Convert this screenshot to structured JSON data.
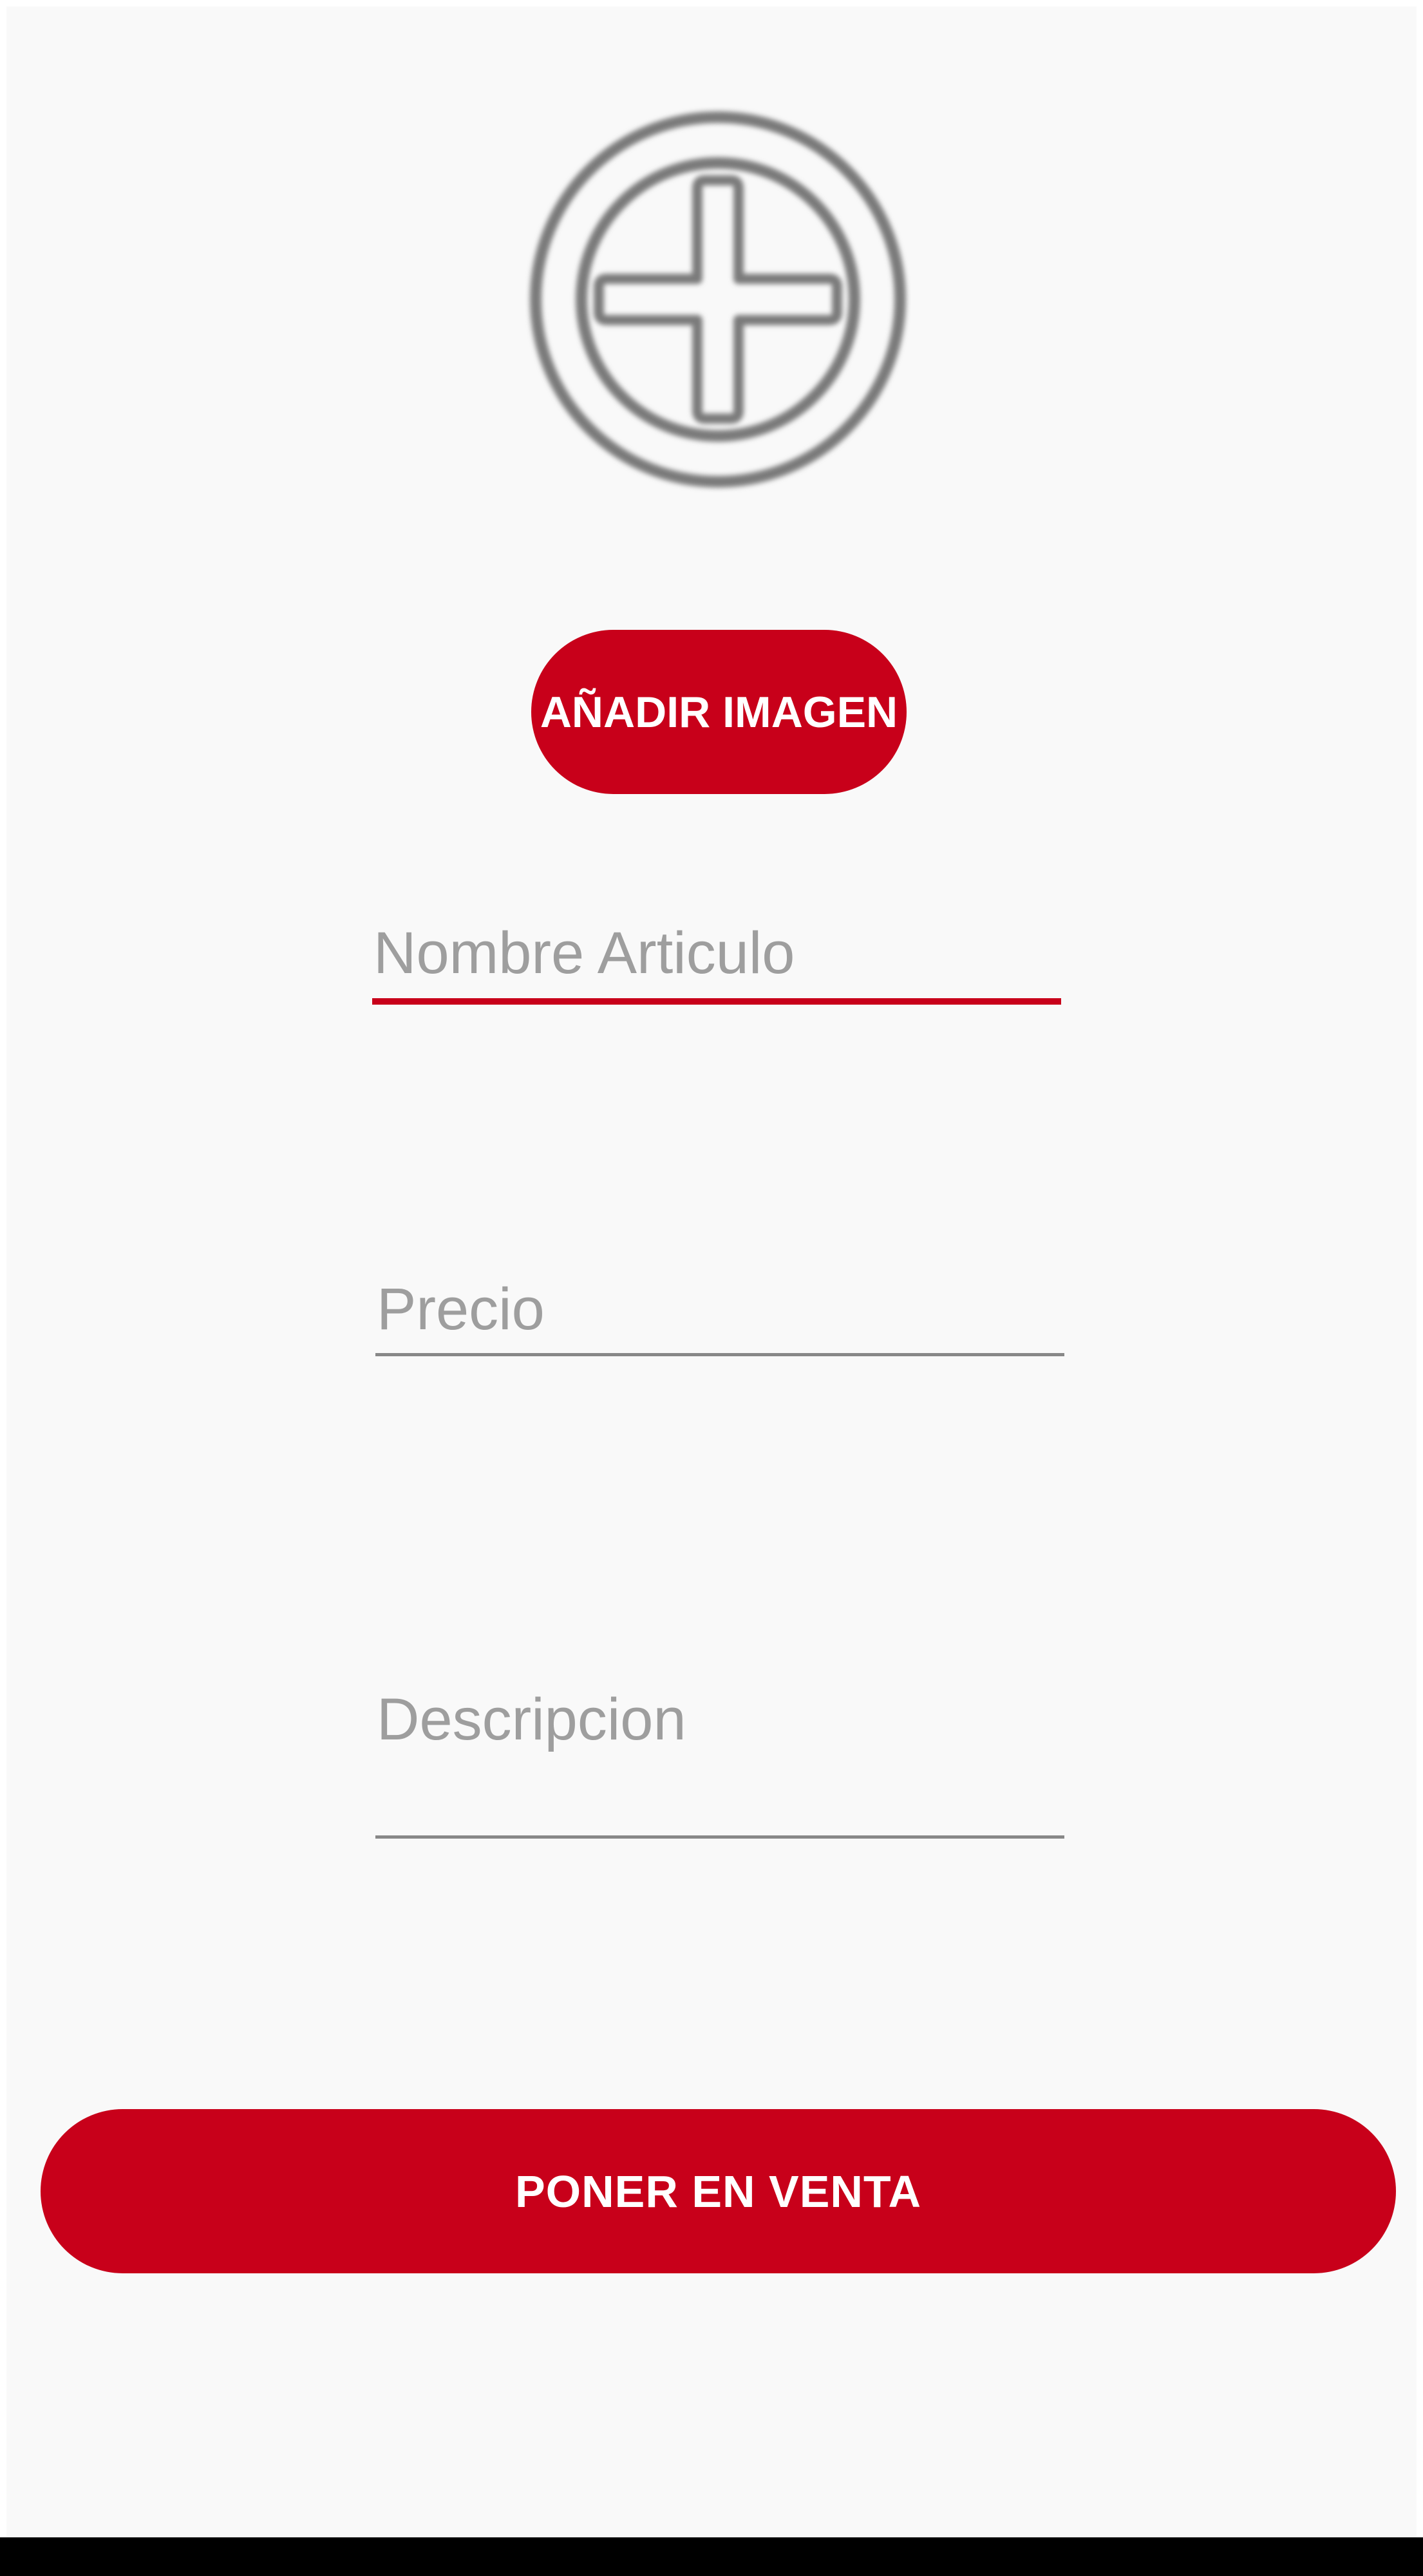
{
  "theme": {
    "accent": "#c8001a",
    "background": "#f9f9f9",
    "placeholder_color": "#9e9e9e",
    "inactive_underline": "#888888",
    "button_text": "#ffffff",
    "icon_color": "#7a7a7a"
  },
  "image_picker": {
    "icon": "add-circle-icon",
    "button_label": "AÑADIR IMAGEN"
  },
  "form": {
    "name": {
      "placeholder": "Nombre Articulo",
      "value": "",
      "focused": true
    },
    "price": {
      "placeholder": "Precio",
      "value": ""
    },
    "description": {
      "placeholder": "Descripcion",
      "value": ""
    }
  },
  "actions": {
    "submit_label": "PONER EN VENTA"
  }
}
